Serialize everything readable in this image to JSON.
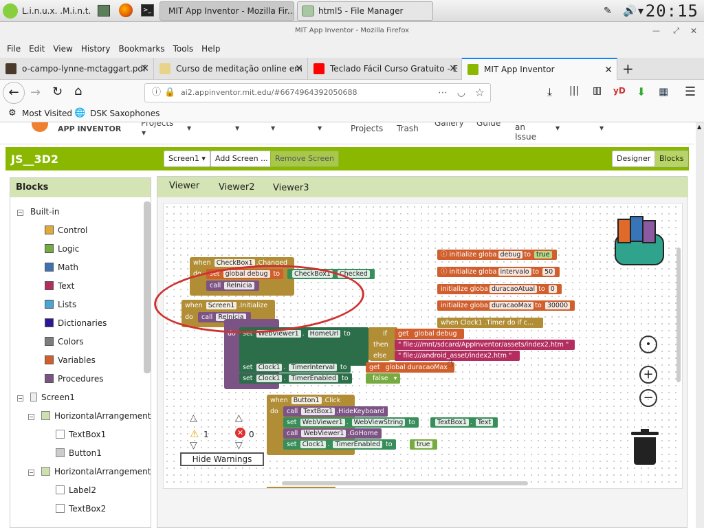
{
  "taskbar": {
    "menu_label": "L.i.n.u.x. .M.i.n.t.",
    "windows": [
      {
        "label": "MIT App Inventor - Mozilla Fir...",
        "active": true
      },
      {
        "label": "html5 - File Manager",
        "active": false
      }
    ],
    "clock": "20:15"
  },
  "firefox": {
    "window_title": "MIT App Inventor - Mozilla Firefox",
    "menu": [
      "File",
      "Edit",
      "View",
      "History",
      "Bookmarks",
      "Tools",
      "Help"
    ],
    "tabs": [
      {
        "label": "o-campo-lynne-mctaggart.pdf",
        "color": "#444444"
      },
      {
        "label": "Curso de meditação online em",
        "color": "#e9d28a"
      },
      {
        "label": "Teclado Fácil Curso Gratuito - E",
        "color": "#ff0000"
      },
      {
        "label": "MIT App Inventor",
        "color": "#8ab800",
        "active": true
      }
    ],
    "url": "ai2.appinventor.mit.edu/#6674964392050688",
    "bookmarks": [
      "Most Visited",
      "DSK Saxophones"
    ]
  },
  "appinventor": {
    "brand": "APP INVENTOR",
    "top_menu": [
      "Projects",
      "Projects",
      "Trash",
      "Gallery",
      "Guide",
      "an Issue"
    ],
    "project_name": "JS__3D2",
    "screen_select": "Screen1 ▾",
    "add_screen": "Add Screen ...",
    "remove_screen": "Remove Screen",
    "designer": "Designer",
    "blocks_btn": "Blocks",
    "panel_title": "Blocks",
    "builtin_label": "Built-in",
    "builtin": [
      {
        "label": "Control",
        "color": "#e1a93a"
      },
      {
        "label": "Logic",
        "color": "#77ab41"
      },
      {
        "label": "Math",
        "color": "#3f71b5"
      },
      {
        "label": "Text",
        "color": "#b32d5e"
      },
      {
        "label": "Lists",
        "color": "#49a6d4"
      },
      {
        "label": "Dictionaries",
        "color": "#2d1799"
      },
      {
        "label": "Colors",
        "color": "#7d7d7d"
      },
      {
        "label": "Variables",
        "color": "#d05f2d"
      },
      {
        "label": "Procedures",
        "color": "#7c5385"
      }
    ],
    "components": [
      "Screen1",
      "HorizontalArrangement",
      "TextBox1",
      "Button1",
      "HorizontalArrangement",
      "Label2",
      "TextBox2"
    ],
    "viewer_tabs": [
      "Viewer",
      "Viewer2",
      "Viewer3"
    ],
    "warnings": {
      "count": "1",
      "errors": "0",
      "hide_label": "Hide Warnings"
    }
  },
  "blocks": {
    "init1": {
      "kw": "initialize globa",
      "name": "debug",
      "to": "to",
      "val": "true"
    },
    "init2": {
      "kw": "initialize globa",
      "name": "intervalo",
      "to": "to",
      "val": "50"
    },
    "init3": {
      "kw": "initialize globa",
      "name": "duracaoAtual",
      "to": "to",
      "val": "0"
    },
    "init4": {
      "kw": "initialize globa",
      "name": "duracaoMax",
      "to": "to",
      "val": "30000"
    },
    "collapsed": "when  Clock1 .Timer do if c...",
    "cb": {
      "when": "when",
      "comp": "CheckBox1",
      "evt": ".Changed",
      "do": "do",
      "set": "set",
      "var": "global debug",
      "to": "to",
      "comp2": "CheckBox1",
      "prop": "Checked",
      "call": "call",
      "proc": "ReInicia"
    },
    "scr": {
      "when": "when",
      "comp": "Screen1",
      "evt": ".Initialize",
      "do": "do",
      "call": "call",
      "proc": "ReInicia"
    },
    "proc": {
      "do": "do",
      "set": "set",
      "comp": "WebViewer1",
      "prop": "HomeUrl",
      "to": "to",
      "if": "if",
      "get": "get",
      "var": "global debug",
      "then": "then",
      "else": "else",
      "url1": "\" file:///mnt/sdcard/AppInventor/assets/index2.htm \"",
      "url2": "\" file:///android_asset/index2.htm \""
    },
    "proc2": {
      "set": "set",
      "comp": "Clock1",
      "prop": "TimerInterval",
      "to": "to",
      "get": "get",
      "var": "global duracaoMax"
    },
    "proc3": {
      "set": "set",
      "comp": "Clock1",
      "prop": "TimerEnabled",
      "to": "to",
      "val": "false"
    },
    "btn": {
      "when": "when",
      "comp": "Button1",
      "evt": ".Click",
      "do": "do",
      "l1a": "call",
      "l1b": "TextBox1",
      "l1c": ".HideKeyboard",
      "l2a": "set",
      "l2b": "WebViewer1",
      "l2c": "WebViewString",
      "l2d": "to",
      "l2e": "TextBox1",
      "l2f": "Text",
      "l3a": "call",
      "l3b": "WebViewer1",
      "l3c": ".GoHome",
      "l4a": "set",
      "l4b": "Clock1",
      "l4c": "TimerEnabled",
      "l4d": "to",
      "l4e": "true"
    }
  }
}
